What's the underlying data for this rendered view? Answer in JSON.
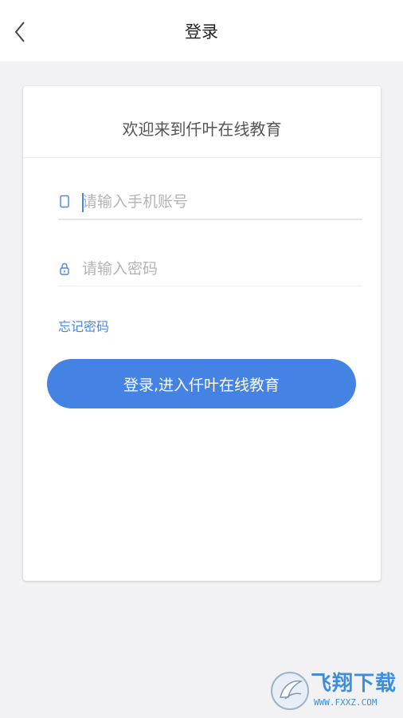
{
  "header": {
    "title": "登录",
    "back_icon": "chevron-left-icon"
  },
  "card": {
    "welcome": "欢迎来到仟叶在线教育",
    "phone_field": {
      "placeholder": "请输入手机账号",
      "value": "",
      "icon": "phone-icon"
    },
    "password_field": {
      "placeholder": "请输入密码",
      "value": "",
      "icon": "lock-icon"
    },
    "forgot_label": "忘记密码",
    "login_label": "登录,进入仟叶在线教育"
  },
  "watermark": {
    "title": "飞翔下载",
    "url": "WWW.FXXZ.COM"
  },
  "colors": {
    "accent": "#4483e4",
    "link": "#4a86e8",
    "background": "#f2f2f4",
    "card": "#ffffff"
  }
}
